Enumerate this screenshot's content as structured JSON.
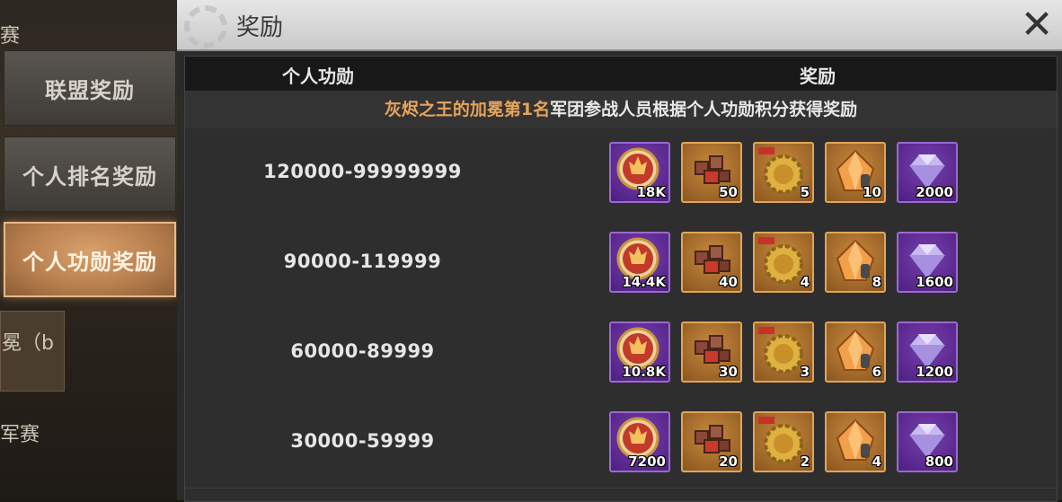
{
  "background": {
    "frag1": "赛",
    "frag2": "冕（b",
    "frag3": "军赛"
  },
  "tabs": [
    {
      "label": "联盟奖励",
      "active": false
    },
    {
      "label": "个人排名奖励",
      "active": false
    },
    {
      "label": "个人功勋奖励",
      "active": true
    }
  ],
  "dialog": {
    "title": "奖励",
    "close_icon": "close-x-icon"
  },
  "table": {
    "header_left": "个人功勋",
    "header_right": "奖励",
    "notice_highlight": "灰烬之王的加冕第1名",
    "notice_rest": "军团参战人员根据个人功勋积分获得奖励",
    "rows": [
      {
        "range": "120000-99999999",
        "items": [
          {
            "icon": "flame-medal-icon",
            "qty": "18K"
          },
          {
            "icon": "crate-pieces-icon",
            "qty": "50"
          },
          {
            "icon": "gold-gear-beast-icon",
            "qty": "5"
          },
          {
            "icon": "amber-crystal-icon",
            "qty": "10"
          },
          {
            "icon": "purple-diamond-icon",
            "qty": "2000"
          }
        ]
      },
      {
        "range": "90000-119999",
        "items": [
          {
            "icon": "flame-medal-icon",
            "qty": "14.4K"
          },
          {
            "icon": "crate-pieces-icon",
            "qty": "40"
          },
          {
            "icon": "gold-gear-beast-icon",
            "qty": "4"
          },
          {
            "icon": "amber-crystal-icon",
            "qty": "8"
          },
          {
            "icon": "purple-diamond-icon",
            "qty": "1600"
          }
        ]
      },
      {
        "range": "60000-89999",
        "items": [
          {
            "icon": "flame-medal-icon",
            "qty": "10.8K"
          },
          {
            "icon": "crate-pieces-icon",
            "qty": "30"
          },
          {
            "icon": "gold-gear-beast-icon",
            "qty": "3"
          },
          {
            "icon": "amber-crystal-icon",
            "qty": "6"
          },
          {
            "icon": "purple-diamond-icon",
            "qty": "1200"
          }
        ]
      },
      {
        "range": "30000-59999",
        "items": [
          {
            "icon": "flame-medal-icon",
            "qty": "7200"
          },
          {
            "icon": "crate-pieces-icon",
            "qty": "20"
          },
          {
            "icon": "gold-gear-beast-icon",
            "qty": "2"
          },
          {
            "icon": "amber-crystal-icon",
            "qty": "4"
          },
          {
            "icon": "purple-diamond-icon",
            "qty": "800"
          }
        ]
      }
    ]
  }
}
